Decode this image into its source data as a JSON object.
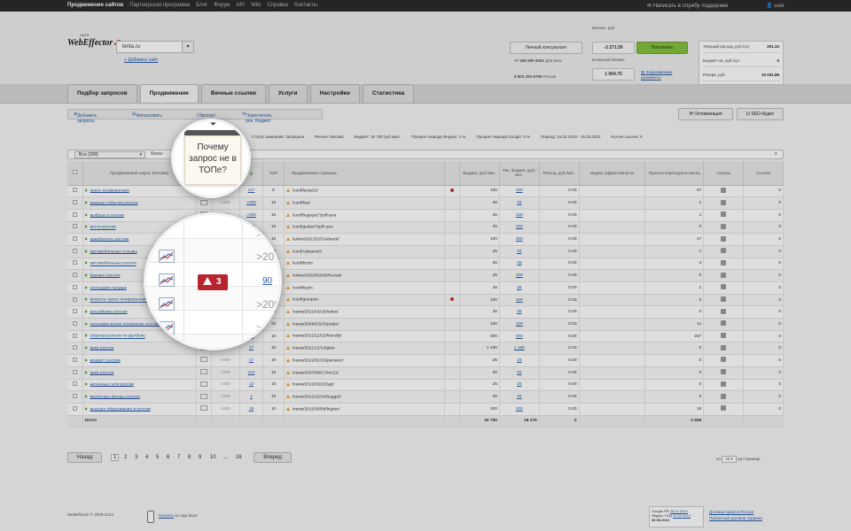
{
  "topnav": {
    "links": [
      "Продвижение сайтов",
      "Партнерская программа",
      "Блог",
      "Форум",
      "API",
      "Wiki",
      "Справка",
      "Контакты"
    ],
    "support": "Написать в службу поддержки",
    "user": "user"
  },
  "header": {
    "logo_sub": "via1.0",
    "logo": "WebEffector",
    "site_value": "lenta.ru",
    "add_site": "Добавить сайт",
    "consultant": "Личный консультант",
    "phone1": "+7 495 980 6052",
    "phone1_note": "Для всех",
    "phone2": "8 800 200 6789",
    "phone2_note": "Россия",
    "balance_label": "Баланс, руб.",
    "balance": "-2 271.59",
    "topup": "Пополнить",
    "bonus_label": "Бонусный баланс",
    "bonus": "1 064.75",
    "docs": "Закрывающие документы",
    "stats": [
      {
        "label": "Текущий расход, руб./сут.",
        "value": "201.34"
      },
      {
        "label": "Бюджет на, руб./сут.",
        "value": "0"
      },
      {
        "label": "Резерв, руб.",
        "value": "10 031.86"
      }
    ]
  },
  "tabs": [
    "Подбор запросов",
    "Продвижение",
    "Вечные ссылки",
    "Услуги",
    "Настройки",
    "Статистика"
  ],
  "toolbar": {
    "add": "Добавить запросы",
    "filter": "Фильтровать",
    "export": "Экспорт",
    "recalc": "Пересчитать рек. бюджет",
    "optimization": "Оптимизация",
    "seo_audit": "SEO-Аудит"
  },
  "info": {
    "status": "Статус кампании: Запущена",
    "region": "Регион: Москва",
    "budget": "Бюджет: 30 750 руб./мес.",
    "yandex": "Процент вывода Яндекс: 1 %",
    "google": "Процент вывода Google: 3 %",
    "period": "Период: 15.02.2013 - 15.03.2013",
    "links": "Кол-во ссылок: 0"
  },
  "filter": {
    "select": "Все (308)",
    "label": "Фильт"
  },
  "grid": {
    "headers": [
      "",
      "Продвигаемый запрос (Москва)",
      "",
      "",
      "",
      "ТОП",
      "Продвигаемая страница",
      "",
      "Бюджет, руб./мес.",
      "Рек. бюджет, руб./мес.",
      "Расход, руб./мес.",
      "Индекс эффективности",
      "Прогноз переходов в месяц",
      "Анкоры",
      "Ссылки"
    ],
    "rows": [
      {
        "kw": "пресс конференция",
        "y": ">200",
        "g": "117",
        "top": "6",
        "url": "/conf/lenta/10",
        "red": true,
        "b": "100",
        "rb": "200",
        "exp": "0.00",
        "fc": "67",
        "links": "0"
      },
      {
        "kw": "важные события россии",
        "y": ">200",
        "g": ">200",
        "top": "10",
        "url": "/conf/live/",
        "red": false,
        "b": "25",
        "rb": "25",
        "exp": "0.00",
        "fc": "1",
        "links": "0"
      },
      {
        "kw": "выборы в россии",
        "y": ">200",
        "g": ">200",
        "top": "10",
        "url": "/conf/hugopic/?pdf=yes",
        "red": false,
        "b": "25",
        "rb": "100",
        "exp": "0.00",
        "fc": "1",
        "links": "0"
      },
      {
        "kw": "вести россия",
        "y": ">200",
        "g": "138",
        "top": "10",
        "url": "/conf/gurlev/?pdf=yes",
        "red": false,
        "b": "25",
        "rb": "100",
        "exp": "0.00",
        "fc": "0",
        "links": "0"
      },
      {
        "kw": "авиабилеты россия",
        "y": ">200",
        "g": ">200",
        "top": "10",
        "url": "/online/2013/10/14/aerol/",
        "red": false,
        "b": "100",
        "rb": "200",
        "exp": "0.00",
        "fc": "17",
        "links": "0"
      },
      {
        "kw": "автомобильные отзывы",
        "y": ">200",
        "g": ">200",
        "top": "10",
        "url": "/conf/cubaevich",
        "red": false,
        "b": "25",
        "rb": "25",
        "exp": "0.00",
        "fc": "1",
        "links": "0"
      },
      {
        "kw": "автомобильные россия",
        "y": ">200",
        "g": ">200",
        "top": "10",
        "url": "/conf/kuzin",
        "red": false,
        "b": "25",
        "rb": "25",
        "exp": "0.00",
        "fc": "4",
        "links": "0"
      },
      {
        "kw": "банкинг россия",
        "y": ">200",
        "g": "90",
        "top": "10",
        "url": "/online/2010/03/05/hurnai/",
        "red": false,
        "b": "25",
        "rb": "100",
        "exp": "0.00",
        "fc": "0",
        "links": "0"
      },
      {
        "kw": "география продаж",
        "y": ">200",
        "g": ">200",
        "top": "10",
        "url": "/conf/kuzin",
        "red": false,
        "b": "25",
        "rb": "25",
        "exp": "0.00",
        "fc": "1",
        "links": "0"
      },
      {
        "kw": "вопросы пресс конференции",
        "y": ">200",
        "g": ">200",
        "top": "10",
        "url": "/conf/groupon",
        "red": true,
        "b": "100",
        "rb": "100",
        "exp": "0.00",
        "fc": "2",
        "links": "0"
      },
      {
        "kw": "российские россия",
        "y": ">200",
        "g": ">200",
        "top": "10",
        "url": "/news/2011/03/15/tanks/",
        "red": false,
        "b": "25",
        "rb": "25",
        "exp": "0.00",
        "fc": "0",
        "links": "0"
      },
      {
        "kw": "географическое положение россии",
        "y": ">200",
        "g": ">200",
        "top": "10",
        "url": "/news/2009/03/25/prabo/",
        "red": false,
        "b": "100",
        "rb": "100",
        "exp": "0.00",
        "fc": "11",
        "links": "0"
      },
      {
        "kw": "сборная россии по футболу",
        "y": ">200",
        "g": "98",
        "top": "10",
        "url": "/news/2011/12/22/friendly/",
        "red": false,
        "b": "200",
        "rb": "200",
        "exp": "0.00",
        "fc": "257",
        "links": "0"
      },
      {
        "kw": "вики россия",
        "y": ">200",
        "g": "17",
        "top": "10",
        "url": "/news/2011/12/13/plan",
        "red": false,
        "b": "1 450",
        "rb": "1 150",
        "exp": "0.00",
        "fc": "0",
        "links": "0"
      },
      {
        "kw": "возраст россии",
        "y": ">200",
        "g": "17",
        "top": "10",
        "url": "/news/2012/01/18/pension/",
        "red": false,
        "b": "25",
        "rb": "25",
        "exp": "0.00",
        "fc": "0",
        "links": "0"
      },
      {
        "kw": "вики россия",
        "y": ">200",
        "g": "114",
        "top": "10",
        "url": "/news/2007/08/17/mc21/",
        "red": false,
        "b": "25",
        "rb": "25",
        "exp": "0.00",
        "fc": "0",
        "links": "0"
      },
      {
        "kw": "антенные сети россии",
        "y": ">200",
        "g": "13",
        "top": "10",
        "url": "/news/2012/03/15/sgt/",
        "red": false,
        "b": "25",
        "rb": "25",
        "exp": "0.00",
        "fc": "0",
        "links": "0"
      },
      {
        "kw": "валютные фонды россии",
        "y": ">200",
        "g": "1",
        "top": "10",
        "url": "/news/2011/10/14/nugget/",
        "red": false,
        "b": "25",
        "rb": "25",
        "exp": "0.00",
        "fc": "0",
        "links": "0"
      },
      {
        "kw": "высшее образование в россии",
        "y": ">200",
        "g": "19",
        "top": "10",
        "url": "/news/2011/08/09/higher/",
        "red": false,
        "b": "200",
        "rb": "200",
        "exp": "0.00",
        "fc": "16",
        "links": "0"
      }
    ],
    "total": {
      "label": "Итого",
      "b": "30 750",
      "rb": "28 275",
      "exp": "0",
      "fc": "2 656"
    }
  },
  "pager": {
    "prev": "Назад",
    "pages": [
      "1",
      "2",
      "3",
      "4",
      "5",
      "6",
      "7",
      "8",
      "9",
      "10",
      "...",
      "16"
    ],
    "next": "Вперед",
    "perpage_prefix": "по",
    "perpage_value": "20",
    "perpage_suffix": "на странице"
  },
  "footer": {
    "copyright": "WebEffector © 2009-2013",
    "app_link": "Скачать",
    "app_suffix": "из App Store",
    "badge_pr": "Google PR",
    "badge_pr_date": "26.02.2013",
    "badge_tic": "Яндекс ТИЦ",
    "badge_tic_date": "22.02.2013",
    "badge_date": "30.08.2013",
    "offer_ru": "Договор-оферта Россия",
    "offer_ua": "Публичный договор Украина"
  },
  "lens1": {
    "tooltip": "Почему запрос не в ТОПе?"
  },
  "lens2": {
    "warning_count": "3",
    "values": [
      ">200",
      ">200",
      "90",
      ">200",
      ">200"
    ]
  },
  "colors": {
    "accent": "#2a5ea8",
    "topup": "#86c23f",
    "warning": "#b8242f"
  }
}
